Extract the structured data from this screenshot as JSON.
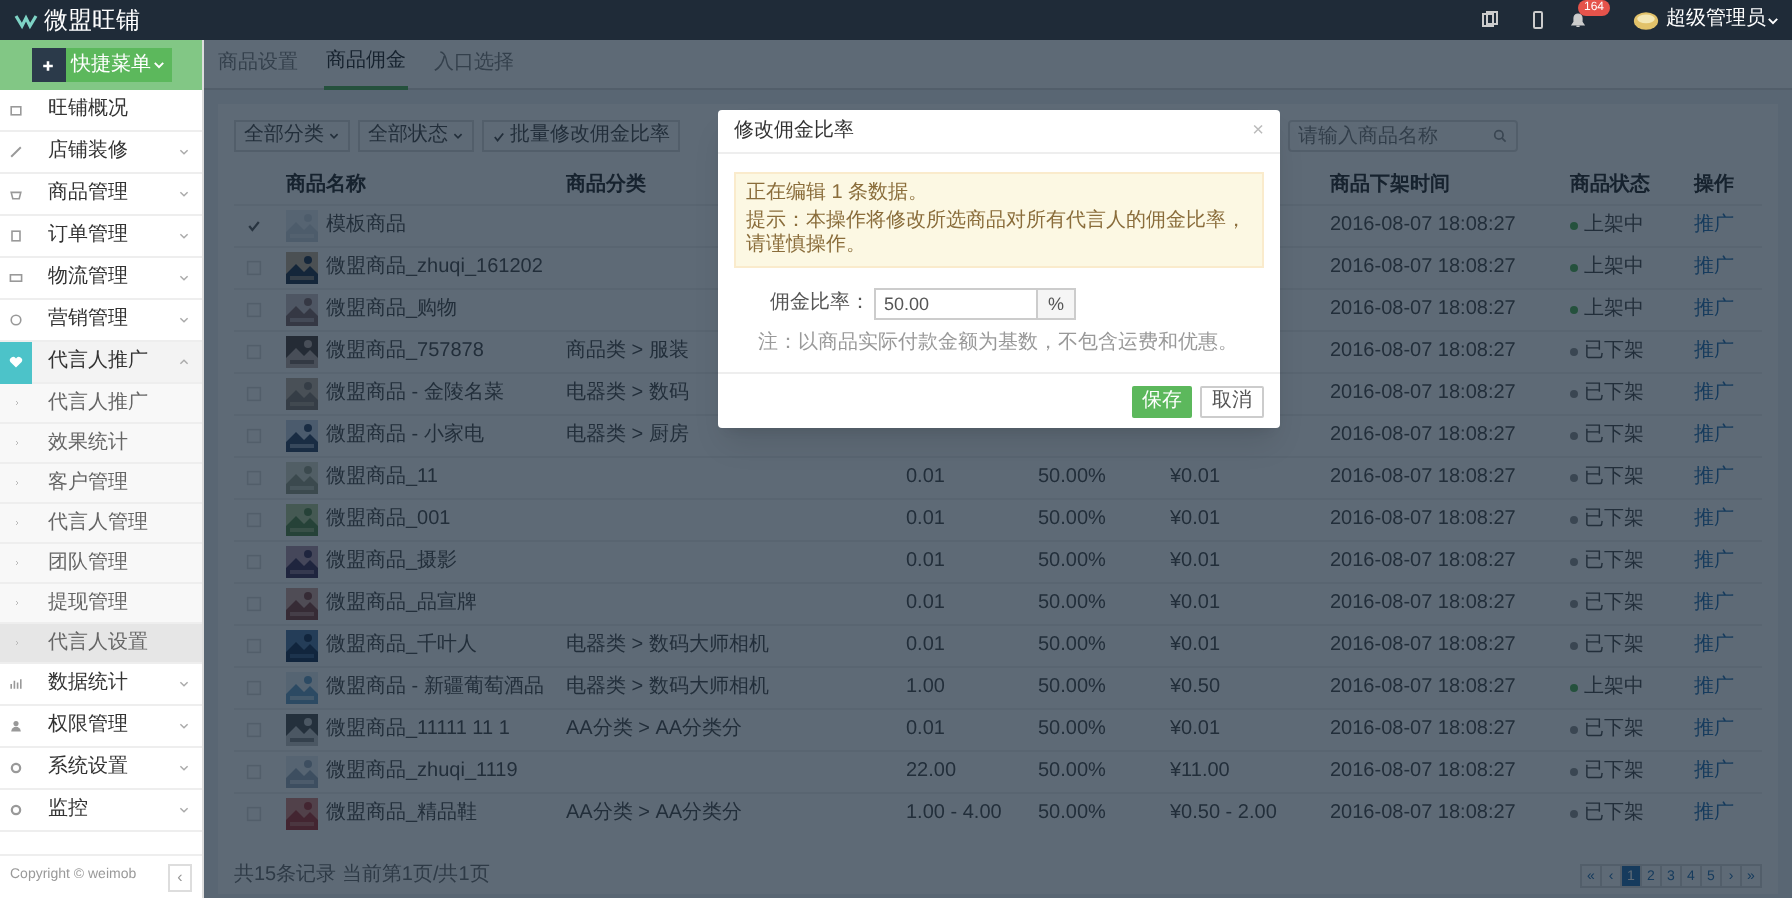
{
  "topbar": {
    "logo": "微盟旺铺",
    "notification_count": "164",
    "user": "超级管理员"
  },
  "sidebar": {
    "quick_button": "快捷菜单",
    "items": [
      {
        "label": "旺铺概况",
        "kind": "link",
        "expanded": false,
        "selected": false
      },
      {
        "label": "店铺装修",
        "kind": "group",
        "expanded": false,
        "selected": false
      },
      {
        "label": "商品管理",
        "kind": "group",
        "expanded": false,
        "selected": false
      },
      {
        "label": "订单管理",
        "kind": "group",
        "expanded": false,
        "selected": false
      },
      {
        "label": "物流管理",
        "kind": "group",
        "expanded": false,
        "selected": false
      },
      {
        "label": "营销管理",
        "kind": "group",
        "expanded": false,
        "selected": false
      },
      {
        "label": "代言人推广",
        "kind": "group",
        "expanded": true,
        "selected": true,
        "children": [
          {
            "label": "代言人推广",
            "selected": false
          },
          {
            "label": "效果统计",
            "selected": false
          },
          {
            "label": "客户管理",
            "selected": false
          },
          {
            "label": "代言人管理",
            "selected": false
          },
          {
            "label": "团队管理",
            "selected": false
          },
          {
            "label": "提现管理",
            "selected": false
          },
          {
            "label": "代言人设置",
            "selected": true
          }
        ]
      },
      {
        "label": "数据统计",
        "kind": "group",
        "expanded": false,
        "selected": false
      },
      {
        "label": "权限管理",
        "kind": "group",
        "expanded": false,
        "selected": false
      },
      {
        "label": "系统设置",
        "kind": "group",
        "expanded": false,
        "selected": false
      },
      {
        "label": "监控",
        "kind": "group",
        "expanded": false,
        "selected": false
      }
    ],
    "copyright": "Copyright © weimob",
    "collapse_button": "‹"
  },
  "tabs": [
    {
      "label": "商品设置",
      "selected": false
    },
    {
      "label": "商品佣金",
      "selected": true
    },
    {
      "label": "入口选择",
      "selected": false
    }
  ],
  "toolbar": {
    "category_filter": "全部分类",
    "status_filter": "全部状态",
    "batch_button": "批量修改佣金比率",
    "search": {
      "placeholder": "请输入商品名称"
    }
  },
  "table": {
    "header": {
      "name": "商品名称",
      "category": "商品分类",
      "time": "商品下架时间",
      "status": "商品状态",
      "action": "操作"
    },
    "rows": [
      {
        "selected": true,
        "name": "模板商品",
        "time": "2016-08-07 18:08:27",
        "status": {
          "label": "上架中",
          "kind": "on"
        },
        "action": "推广"
      },
      {
        "selected": false,
        "name": "微盟商品_zhuqi_161202",
        "time": "2016-08-07 18:08:27",
        "status": {
          "label": "上架中",
          "kind": "on"
        },
        "action": "推广"
      },
      {
        "selected": false,
        "name": "微盟商品_购物",
        "time": "2016-08-07 18:08:27",
        "status": {
          "label": "上架中",
          "kind": "on"
        },
        "action": "推广"
      },
      {
        "selected": false,
        "name": "微盟商品_757878",
        "category": "商品类 > 服装",
        "time": "2016-08-07 18:08:27",
        "status": {
          "label": "已下架",
          "kind": "off"
        },
        "action": "推广"
      },
      {
        "selected": false,
        "name": "微盟商品 - 金陵名菜",
        "category": "电器类 > 数码",
        "time": "2016-08-07 18:08:27",
        "status": {
          "label": "已下架",
          "kind": "off"
        },
        "action": "推广"
      },
      {
        "selected": false,
        "name": "微盟商品 - 小家电",
        "category": "电器类 > 厨房",
        "time": "2016-08-07 18:08:27",
        "status": {
          "label": "已下架",
          "kind": "off"
        },
        "action": "推广"
      },
      {
        "selected": false,
        "name": "微盟商品_11",
        "price": "0.01",
        "rate": "50.00%",
        "commission": "¥0.01",
        "time": "2016-08-07 18:08:27",
        "status": {
          "label": "已下架",
          "kind": "off"
        },
        "action": "推广"
      },
      {
        "selected": false,
        "name": "微盟商品_001",
        "price": "0.01",
        "rate": "50.00%",
        "commission": "¥0.01",
        "time": "2016-08-07 18:08:27",
        "status": {
          "label": "已下架",
          "kind": "off"
        },
        "action": "推广"
      },
      {
        "selected": false,
        "name": "微盟商品_摄影",
        "price": "0.01",
        "rate": "50.00%",
        "commission": "¥0.01",
        "time": "2016-08-07 18:08:27",
        "status": {
          "label": "已下架",
          "kind": "off"
        },
        "action": "推广"
      },
      {
        "selected": false,
        "name": "微盟商品_品宣牌",
        "price": "0.01",
        "rate": "50.00%",
        "commission": "¥0.01",
        "time": "2016-08-07 18:08:27",
        "status": {
          "label": "已下架",
          "kind": "off"
        },
        "action": "推广"
      },
      {
        "selected": false,
        "name": "微盟商品_千叶人",
        "category": "电器类 > 数码大师相机",
        "price": "0.01",
        "rate": "50.00%",
        "commission": "¥0.01",
        "time": "2016-08-07 18:08:27",
        "status": {
          "label": "已下架",
          "kind": "off"
        },
        "action": "推广"
      },
      {
        "selected": false,
        "name": "微盟商品 - 新疆葡萄酒品",
        "category": "电器类 > 数码大师相机",
        "price": "1.00",
        "rate": "50.00%",
        "commission": "¥0.50",
        "time": "2016-08-07 18:08:27",
        "status": {
          "label": "上架中",
          "kind": "on"
        },
        "action": "推广"
      },
      {
        "selected": false,
        "name": "微盟商品_11111 11 1",
        "category": "AA分类 > AA分类分",
        "price": "0.01",
        "rate": "50.00%",
        "commission": "¥0.01",
        "time": "2016-08-07 18:08:27",
        "status": {
          "label": "已下架",
          "kind": "off"
        },
        "action": "推广"
      },
      {
        "selected": false,
        "name": "微盟商品_zhuqi_1119",
        "price": "22.00",
        "rate": "50.00%",
        "commission": "¥11.00",
        "time": "2016-08-07 18:08:27",
        "status": {
          "label": "已下架",
          "kind": "off"
        },
        "action": "推广"
      },
      {
        "selected": false,
        "name": "微盟商品_精品鞋",
        "category": "AA分类 > AA分类分",
        "price": "1.00 - 4.00",
        "rate": "50.00%",
        "commission": "¥0.50 - 2.00",
        "time": "2016-08-07 18:08:27",
        "status": {
          "label": "已下架",
          "kind": "off"
        },
        "action": "推广"
      }
    ]
  },
  "footer": "共15条记录 当前第1页/共1页",
  "pagination": [
    {
      "label": "«",
      "selected": false
    },
    {
      "label": "‹",
      "selected": false
    },
    {
      "label": "1",
      "selected": true
    },
    {
      "label": "2",
      "selected": false
    },
    {
      "label": "3",
      "selected": false
    },
    {
      "label": "4",
      "selected": false
    },
    {
      "label": "5",
      "selected": false
    },
    {
      "label": "›",
      "selected": false
    },
    {
      "label": "»",
      "selected": false
    }
  ],
  "modal": {
    "title": "修改佣金比率",
    "close": "×",
    "alert": [
      "正在编辑 1 条数据。",
      "提示：本操作将修改所选商品对所有代言人的佣金比率，请谨慎操作。"
    ],
    "field_label": "佣金比率：",
    "field_value": "50.00",
    "field_unit": "%",
    "note": "注：以商品实际付款金额为基数，不包含运费和优惠。",
    "save_button": "保存",
    "cancel_button": "取消"
  }
}
